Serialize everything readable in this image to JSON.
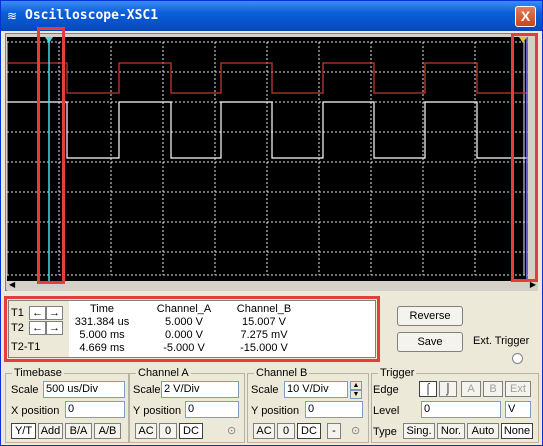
{
  "window": {
    "title": "Oscilloscope-XSC1",
    "close_label": "X"
  },
  "readout": {
    "row_labels": [
      "T1",
      "T2",
      "T2-T1"
    ],
    "headers": {
      "time": "Time",
      "a": "Channel_A",
      "b": "Channel_B"
    },
    "rows": [
      {
        "time": "331.384 us",
        "a": "5.000 V",
        "b": "15.007 V"
      },
      {
        "time": "5.000 ms",
        "a": "0.000 V",
        "b": "7.275 mV"
      },
      {
        "time": "4.669 ms",
        "a": "-5.000 V",
        "b": "-15.000 V"
      }
    ]
  },
  "buttons": {
    "reverse": "Reverse",
    "save": "Save",
    "ext_trigger": "Ext. Trigger"
  },
  "timebase": {
    "title": "Timebase",
    "scale_label": "Scale",
    "scale_value": "500 us/Div",
    "xpos_label": "X position",
    "xpos_value": "0",
    "modes": [
      "Y/T",
      "Add",
      "B/A",
      "A/B"
    ]
  },
  "channel_a": {
    "title": "Channel A",
    "scale_label": "Scale",
    "scale_value": "2  V/Div",
    "ypos_label": "Y position",
    "ypos_value": "0",
    "coupling": [
      "AC",
      "0",
      "DC"
    ]
  },
  "channel_b": {
    "title": "Channel B",
    "scale_label": "Scale",
    "scale_value": "10  V/Div",
    "ypos_label": "Y position",
    "ypos_value": "0",
    "coupling": [
      "AC",
      "0",
      "DC",
      "-"
    ]
  },
  "trigger": {
    "title": "Trigger",
    "edge_label": "Edge",
    "sources": [
      "A",
      "B",
      "Ext"
    ],
    "level_label": "Level",
    "level_value": "0",
    "level_unit": "V",
    "type_label": "Type",
    "types": [
      "Sing.",
      "Nor.",
      "Auto",
      "None"
    ]
  }
}
